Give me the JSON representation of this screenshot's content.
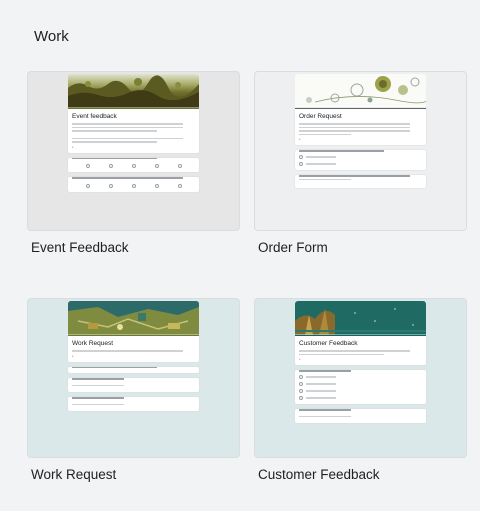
{
  "section": {
    "title": "Work"
  },
  "templates": [
    {
      "label": "Event Feedback",
      "form_title": "Event feedback",
      "banner_color": "#5e5a22",
      "background": "#e8e8e8"
    },
    {
      "label": "Order Form",
      "form_title": "Order Request",
      "banner_color": "#f5f5f0",
      "background": "#f0f1f2"
    },
    {
      "label": "Work Request",
      "form_title": "Work Request",
      "banner_color": "#7b8a3c",
      "background": "#dde9ea"
    },
    {
      "label": "Customer Feedback",
      "form_title": "Customer Feedback",
      "banner_color": "#1f6b63",
      "background": "#dde9ea"
    }
  ]
}
